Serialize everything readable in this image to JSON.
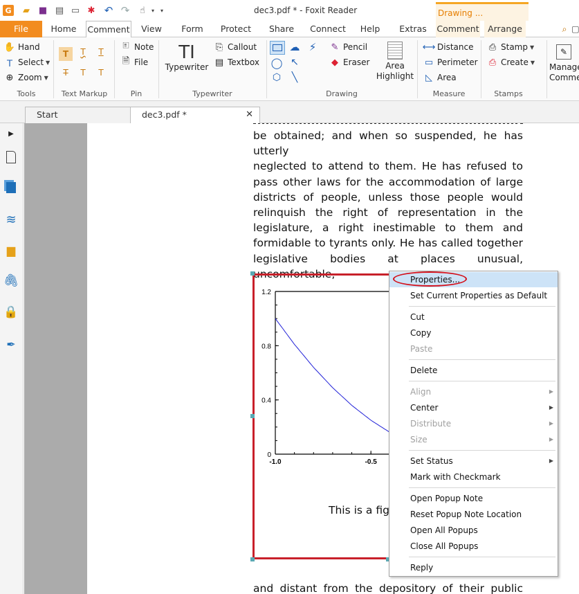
{
  "window": {
    "title": "dec3.pdf * - Foxit Reader",
    "context_tab": "Drawing ..."
  },
  "ribbon_tabs": [
    "File",
    "Home",
    "Comment",
    "View",
    "Form",
    "Protect",
    "Share",
    "Connect",
    "Help",
    "Extras",
    "Comment",
    "Arrange"
  ],
  "active_tab": "Comment",
  "ribbon": {
    "tools": {
      "label": "Tools",
      "hand": "Hand",
      "select": "Select",
      "zoom": "Zoom"
    },
    "text_markup": {
      "label": "Text Markup"
    },
    "pin": {
      "label": "Pin",
      "note": "Note",
      "file": "File"
    },
    "typewriter": {
      "label": "Typewriter",
      "typewriter": "Typewriter",
      "callout": "Callout",
      "textbox": "Textbox"
    },
    "drawing": {
      "label": "Drawing",
      "pencil": "Pencil",
      "eraser": "Eraser",
      "area_highlight_1": "Area",
      "area_highlight_2": "Highlight"
    },
    "measure": {
      "label": "Measure",
      "distance": "Distance",
      "perimeter": "Perimeter",
      "area": "Area"
    },
    "stamps": {
      "label": "Stamps",
      "stamp": "Stamp",
      "create": "Create"
    },
    "manage": {
      "line1": "Manage",
      "line2": "Comment"
    }
  },
  "doc_tabs": [
    {
      "label": "Start"
    },
    {
      "label": "dec3.pdf *"
    }
  ],
  "document": {
    "para1": [
      "be obtained; and when so suspended, he has utterly",
      "neglected to attend to them.  He has refused to",
      "pass other laws for the accommodation of large",
      "districts of people, unless those people would",
      "relinquish the right of representation in the",
      "legislature, a right inestimable to them and",
      "formidable to tyrants only.  He has called together",
      "legislative bodies at places unusual, uncomfortable,"
    ],
    "figure_caption": "This is a figu",
    "para2_first_line": "and distant from the depository of their public"
  },
  "chart_data": {
    "type": "line",
    "series": [
      {
        "x": [
          -1.0,
          -0.9,
          -0.8,
          -0.7,
          -0.6,
          -0.5,
          -0.4,
          -0.3,
          -0.2,
          -0.1,
          0.0
        ],
        "y": [
          1.0,
          0.81,
          0.64,
          0.49,
          0.36,
          0.25,
          0.16,
          0.09,
          0.04,
          0.01,
          0.0
        ],
        "color": "#2323d8"
      }
    ],
    "x_ticks": [
      "-1.0",
      "-0.5"
    ],
    "y_ticks": [
      "0",
      "0.4",
      "0.8",
      "1.2"
    ],
    "xlim": [
      -1.0,
      0.1
    ],
    "ylim": [
      0,
      1.2
    ],
    "grid": false
  },
  "context_menu": [
    {
      "label": "Properties...",
      "enabled": true,
      "highlighted": true
    },
    {
      "label": "Set Current Properties as Default",
      "enabled": true
    },
    {
      "sep": true
    },
    {
      "label": "Cut",
      "enabled": true
    },
    {
      "label": "Copy",
      "enabled": true
    },
    {
      "label": "Paste",
      "enabled": false
    },
    {
      "sep": true
    },
    {
      "label": "Delete",
      "enabled": true
    },
    {
      "sep": true
    },
    {
      "label": "Align",
      "enabled": false,
      "submenu": true
    },
    {
      "label": "Center",
      "enabled": true,
      "submenu": true
    },
    {
      "label": "Distribute",
      "enabled": false,
      "submenu": true
    },
    {
      "label": "Size",
      "enabled": false,
      "submenu": true
    },
    {
      "sep": true
    },
    {
      "label": "Set Status",
      "enabled": true,
      "submenu": true
    },
    {
      "label": "Mark with Checkmark",
      "enabled": true
    },
    {
      "sep": true
    },
    {
      "label": "Open Popup Note",
      "enabled": true
    },
    {
      "label": "Reset Popup Note Location",
      "enabled": true
    },
    {
      "label": "Open All Popups",
      "enabled": true
    },
    {
      "label": "Close All Popups",
      "enabled": true
    },
    {
      "sep": true
    },
    {
      "label": "Reply",
      "enabled": true
    }
  ],
  "colors": {
    "file_tab": "#f28c1f",
    "context_tab_accent": "#f5a623",
    "annotation_border": "#c8202a",
    "highlight_ellipse": "#d4101a",
    "menu_highlight": "#cde3f7"
  }
}
